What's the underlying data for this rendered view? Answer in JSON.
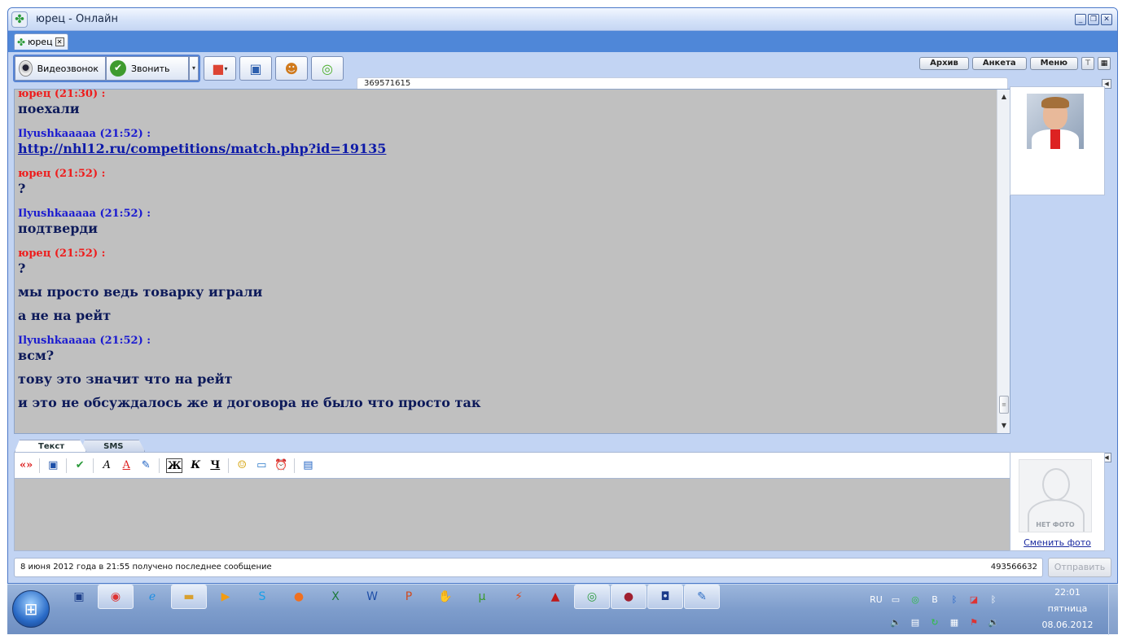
{
  "window": {
    "title": "юрец - Онлайн",
    "tab_label": "юрец",
    "controls": {
      "minimize": "_",
      "restore": "❐",
      "close": "✕"
    }
  },
  "toolbar": {
    "video_call": "Видеозвонок",
    "call": "Звонить",
    "icons": [
      "rubik-cube-icon",
      "floppy-disk-icon",
      "users-icon",
      "attach-icon"
    ]
  },
  "top_menu": {
    "archive": "Архив",
    "profile": "Анкета",
    "menu": "Меню"
  },
  "contact_uin": "369571615",
  "messages": [
    {
      "sender": "юрец (21:30) :",
      "me": true,
      "lines": [
        "поехали"
      ]
    },
    {
      "sender": "Ilyushkaaaaa (21:52) :",
      "me": false,
      "lines": [
        "http://nhl12.ru/competitions/match.php?id=19135"
      ],
      "link": true
    },
    {
      "sender": "юрец (21:52) :",
      "me": true,
      "lines": [
        "?"
      ]
    },
    {
      "sender": "Ilyushkaaaaa (21:52) :",
      "me": false,
      "lines": [
        "подтверди"
      ]
    },
    {
      "sender": "юрец (21:52) :",
      "me": true,
      "lines": [
        "?",
        "мы просто ведь товарку играли",
        "а не на рейт"
      ]
    },
    {
      "sender": "Ilyushkaaaaa (21:52) :",
      "me": false,
      "lines": [
        "всм?",
        "тову это значит что на рейт",
        "и это не обсуждалось же и договора не было что просто так"
      ]
    }
  ],
  "input": {
    "tabs": [
      "Текст",
      "SMS"
    ],
    "format": {
      "bold": "Ж",
      "italic": "К",
      "underline": "Ч",
      "translit": "«»"
    }
  },
  "my_photo": {
    "no_photo_label": "НЕТ ФОТО",
    "change_photo": "Сменить фото"
  },
  "status": {
    "text": "8 июня 2012 года в 21:55 получено последнее сообщение",
    "my_uin": "493566632",
    "send": "Отправить"
  },
  "taskbar": {
    "lang": "RU",
    "time": "22:01",
    "weekday": "пятница",
    "date": "08.06.2012"
  },
  "colors": {
    "me": "#ee1c1c",
    "them": "#1a1ad0",
    "message_text": "#0d1a5a",
    "chat_bg": "#c0c0c0"
  }
}
